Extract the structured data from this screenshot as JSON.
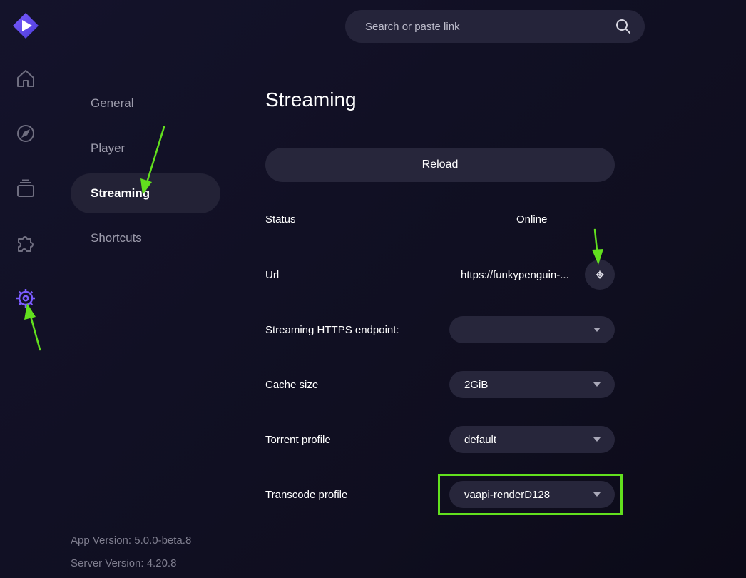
{
  "app": {
    "logo_icon": "play-logo-icon",
    "accent_color": "#6b4cf5"
  },
  "rail": {
    "items": [
      {
        "icon": "home-icon"
      },
      {
        "icon": "compass-icon"
      },
      {
        "icon": "library-icon"
      },
      {
        "icon": "puzzle-icon"
      },
      {
        "icon": "gear-icon",
        "active": true
      }
    ]
  },
  "search": {
    "placeholder": "Search or paste link",
    "icon": "search-icon"
  },
  "nav": {
    "items": [
      {
        "label": "General"
      },
      {
        "label": "Player"
      },
      {
        "label": "Streaming",
        "active": true
      },
      {
        "label": "Shortcuts"
      }
    ]
  },
  "footer": {
    "app_version": "App Version: 5.0.0-beta.8",
    "server_version": "Server Version: 4.20.8"
  },
  "main": {
    "title": "Streaming",
    "reload_label": "Reload",
    "rows": {
      "status": {
        "label": "Status",
        "value": "Online"
      },
      "url": {
        "label": "Url",
        "value": "https://funkypenguin-...",
        "action_icon": "gear-icon"
      },
      "endpoint": {
        "label": "Streaming HTTPS endpoint:",
        "value": ""
      },
      "cache": {
        "label": "Cache size",
        "value": "2GiB"
      },
      "torrent": {
        "label": "Torrent profile",
        "value": "default"
      },
      "transcode": {
        "label": "Transcode profile",
        "value": "vaapi-renderD128"
      }
    }
  },
  "annotations": {
    "color": "#62e01e",
    "arrows": [
      "arrow-annotation-icon",
      "arrow-annotation-icon",
      "arrow-annotation-icon"
    ],
    "highlight": "transcode-profile"
  }
}
